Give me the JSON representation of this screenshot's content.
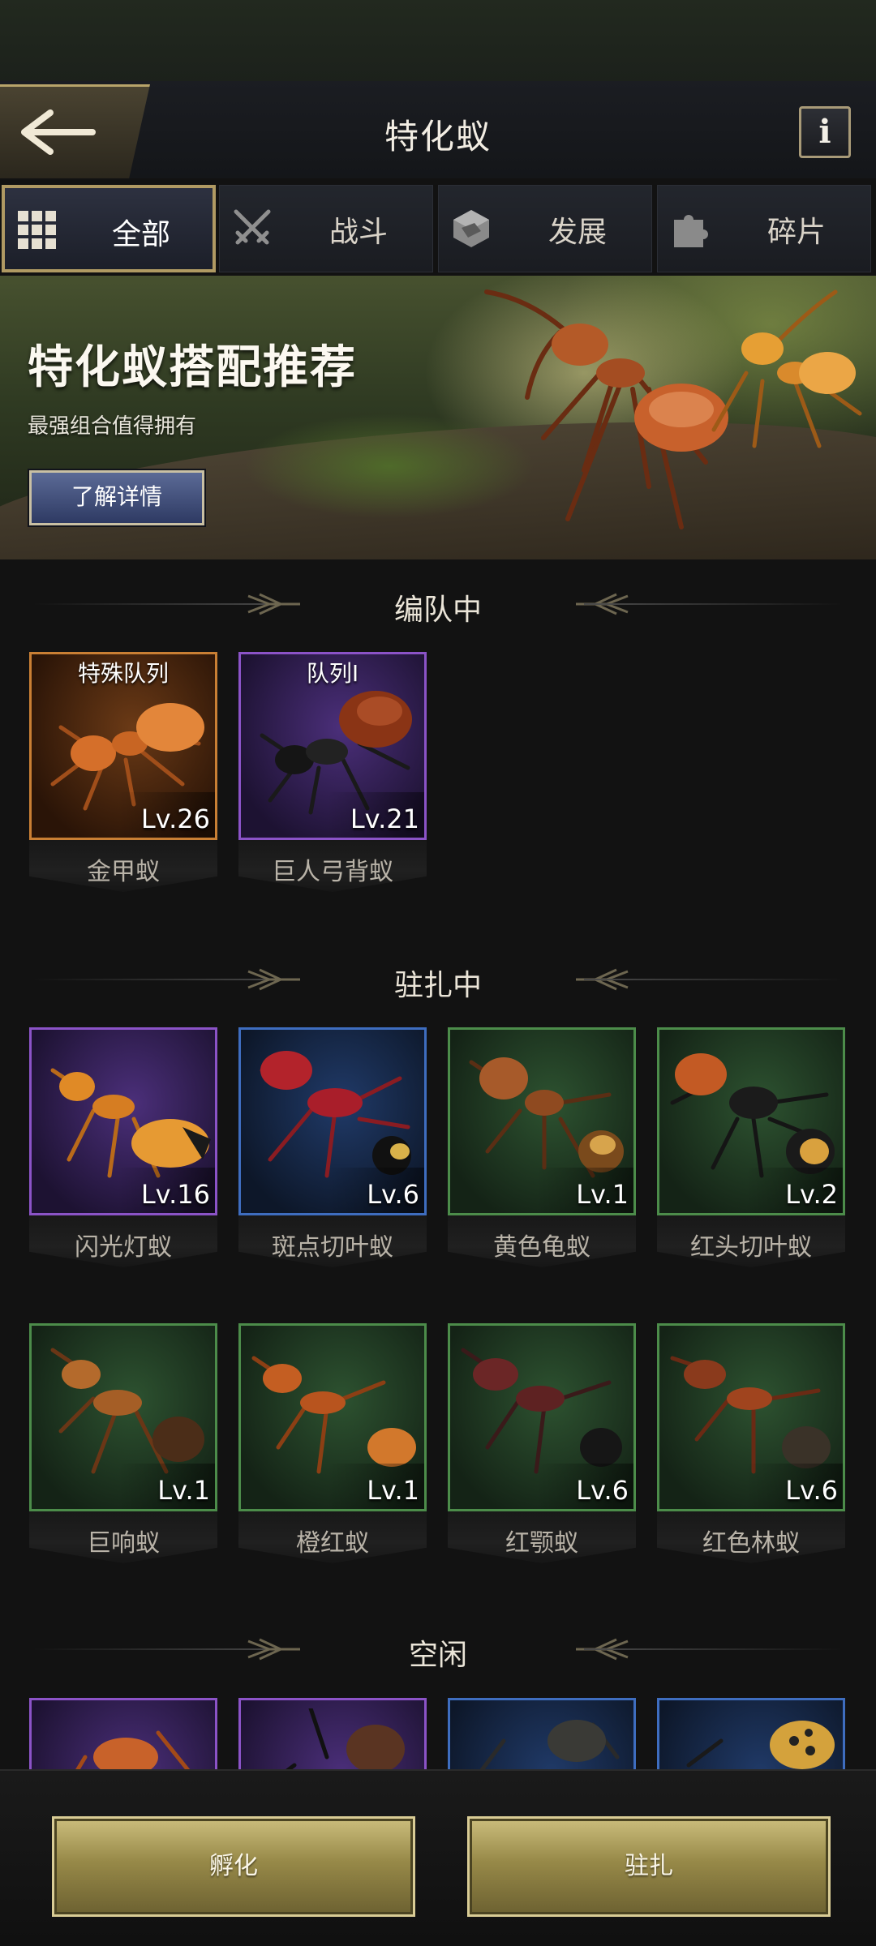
{
  "header": {
    "title": "特化蚁"
  },
  "tabs": [
    {
      "label": "全部",
      "icon": "grid-icon",
      "active": true
    },
    {
      "label": "战斗",
      "icon": "crossed-swords-icon",
      "active": false
    },
    {
      "label": "发展",
      "icon": "resource-cube-icon",
      "active": false
    },
    {
      "label": "碎片",
      "icon": "puzzle-piece-icon",
      "active": false
    }
  ],
  "banner": {
    "title": "特化蚁搭配推荐",
    "subtitle": "最强组合值得拥有",
    "button_label": "了解详情"
  },
  "sections": {
    "formation": {
      "title": "编队中",
      "cards": [
        {
          "name": "金甲蚁",
          "level": "Lv.26",
          "squad": "特殊队列",
          "rarity": "orange"
        },
        {
          "name": "巨人弓背蚁",
          "level": "Lv.21",
          "squad": "队列I",
          "rarity": "purple"
        }
      ]
    },
    "garrison": {
      "title": "驻扎中",
      "cards": [
        {
          "name": "闪光灯蚁",
          "level": "Lv.16",
          "rarity": "purple"
        },
        {
          "name": "斑点切叶蚁",
          "level": "Lv.6",
          "rarity": "blue"
        },
        {
          "name": "黄色龟蚁",
          "level": "Lv.1",
          "rarity": "green"
        },
        {
          "name": "红头切叶蚁",
          "level": "Lv.2",
          "rarity": "green"
        },
        {
          "name": "巨响蚁",
          "level": "Lv.1",
          "rarity": "green"
        },
        {
          "name": "橙红蚁",
          "level": "Lv.1",
          "rarity": "green"
        },
        {
          "name": "红颚蚁",
          "level": "Lv.6",
          "rarity": "green"
        },
        {
          "name": "红色林蚁",
          "level": "Lv.6",
          "rarity": "green"
        }
      ]
    },
    "idle": {
      "title": "空闲",
      "cards": [
        {
          "rarity": "purple"
        },
        {
          "rarity": "purple"
        },
        {
          "rarity": "blue"
        },
        {
          "rarity": "blue"
        }
      ]
    }
  },
  "bottom": {
    "hatch_label": "孵化",
    "garrison_label": "驻扎"
  },
  "colors": {
    "gold_accent": "#b09a63",
    "rarity_orange": "#c97f34",
    "rarity_purple": "#8b53c7",
    "rarity_blue": "#3e6dbf",
    "rarity_green": "#4c8c4a"
  }
}
